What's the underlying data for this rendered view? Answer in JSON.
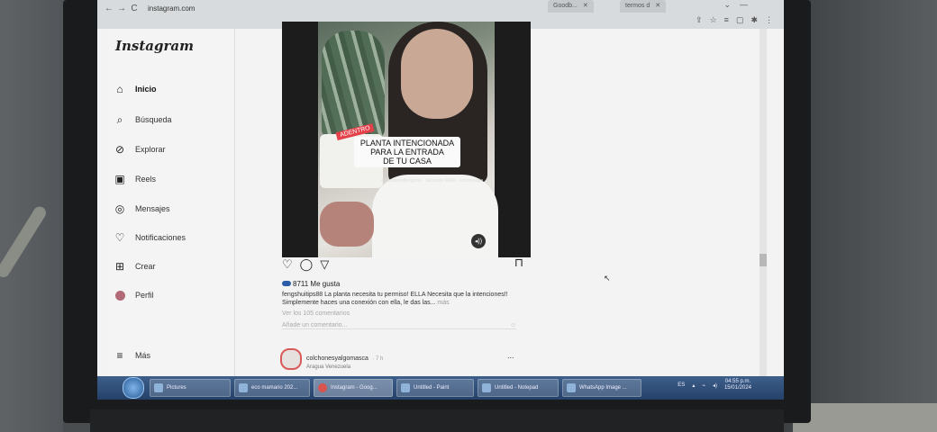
{
  "browser": {
    "url": "instagram.com",
    "tabs": [
      "Goodb...",
      "termos d"
    ],
    "nav": {
      "back": "←",
      "forward": "→",
      "reload": "C"
    }
  },
  "sidebar": {
    "logo": "Instagram",
    "items": [
      {
        "label": "Inicio",
        "icon": "home-icon"
      },
      {
        "label": "Búsqueda",
        "icon": "search-icon"
      },
      {
        "label": "Explorar",
        "icon": "compass-icon"
      },
      {
        "label": "Reels",
        "icon": "reels-icon"
      },
      {
        "label": "Mensajes",
        "icon": "messenger-icon"
      },
      {
        "label": "Notificaciones",
        "icon": "heart-icon"
      },
      {
        "label": "Crear",
        "icon": "plus-square-icon"
      },
      {
        "label": "Perfil",
        "icon": "avatar-icon"
      },
      {
        "label": "Más",
        "icon": "menu-icon"
      }
    ]
  },
  "post": {
    "badge": "ADENTRO",
    "overlay_line1": "PLANTA INTENCIONADA",
    "overlay_line2": "PARA LA ENTRADA",
    "overlay_line3": "DE TU CASA",
    "watermark": "elmundodelfengshui · Sanación Reiki · sonoterapia",
    "likes": "8711 Me gusta",
    "username": "fengshuitips88",
    "caption": "La planta necesita tu permiso! ELLA Necesita que la intenciones!! Simplemente haces una conexión con ella, le das las...",
    "more": "más",
    "view_comments": "Ver los 105 comentarios",
    "add_comment_placeholder": "Añade un comentario..."
  },
  "next_post": {
    "username": "colchonesyalgomasca",
    "time": "· 7 h",
    "location": "Aragua Venezuela",
    "more": "..."
  },
  "taskbar": {
    "items": [
      {
        "label": "Pictures"
      },
      {
        "label": "eco mamario 202..."
      },
      {
        "label": "Instagram - Goog..."
      },
      {
        "label": "Untitled - Paint"
      },
      {
        "label": "Untitled - Notepad"
      },
      {
        "label": "WhatsApp Image ..."
      }
    ],
    "lang": "ES",
    "time": "04:55 p.m.",
    "date": "15/01/2024"
  }
}
